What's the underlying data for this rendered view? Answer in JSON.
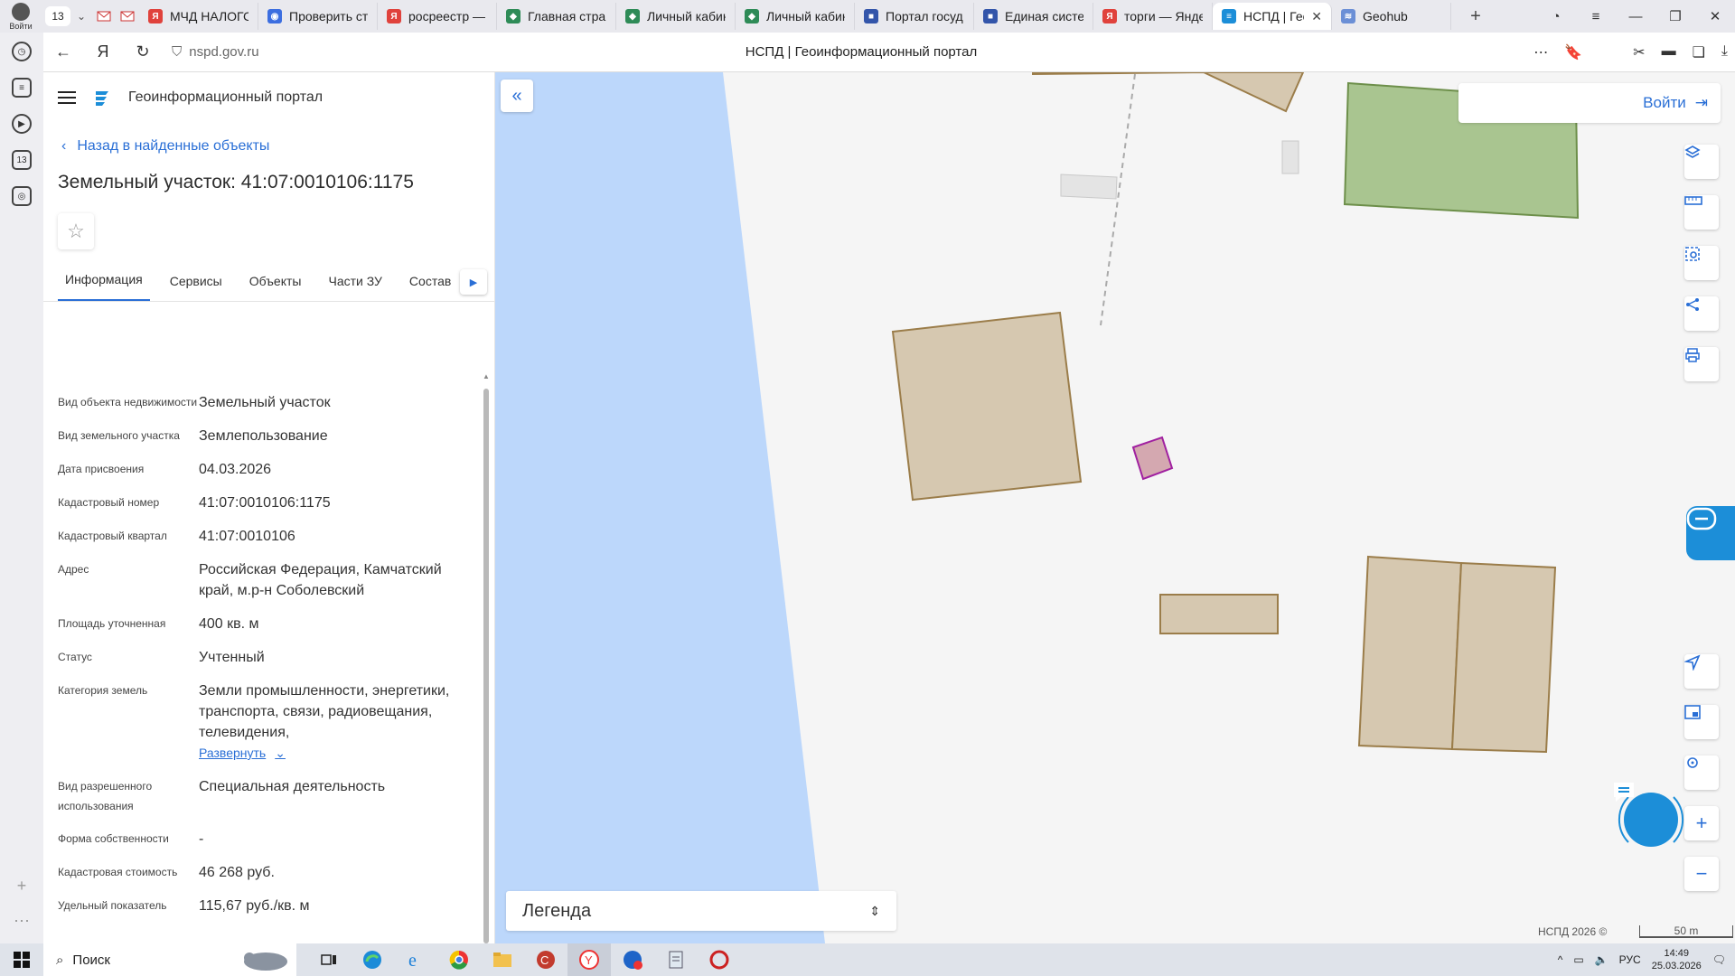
{
  "browser": {
    "profile_label": "Войти",
    "tab_count": "13",
    "tabs": [
      {
        "label": "МЧД НАЛОГС",
        "color": "#e0423c",
        "glyph": "Я"
      },
      {
        "label": "Проверить ст",
        "color": "#3c6ee0",
        "glyph": "◉"
      },
      {
        "label": "росреестр — Я",
        "color": "#e0423c",
        "glyph": "Я"
      },
      {
        "label": "Главная стран",
        "color": "#2e8b57",
        "glyph": "◆"
      },
      {
        "label": "Личный кабин",
        "color": "#2e8b57",
        "glyph": "◆"
      },
      {
        "label": "Личный кабин",
        "color": "#2e8b57",
        "glyph": "◆"
      },
      {
        "label": "Портал госуд",
        "color": "#3355aa",
        "glyph": "■"
      },
      {
        "label": "Единая систе",
        "color": "#3355aa",
        "glyph": "■"
      },
      {
        "label": "торги — Янде",
        "color": "#e0423c",
        "glyph": "Я"
      },
      {
        "label": "НСПД | Гео",
        "color": "#1c8ed8",
        "glyph": "≡"
      },
      {
        "label": "Geohub",
        "color": "#6b8fd6",
        "glyph": "≋"
      }
    ],
    "url": "nspd.gov.ru",
    "page_title": "НСПД | Геоинформационный портал"
  },
  "panel": {
    "portal_name": "Геоинформационный портал",
    "back_label": "Назад в найденные объекты",
    "object_title": "Земельный участок: 41:07:0010106:1175",
    "tabs": [
      "Информация",
      "Сервисы",
      "Объекты",
      "Части ЗУ",
      "Состав"
    ],
    "rows": [
      {
        "label": "Вид объекта недвижимости",
        "value": "Земельный участок"
      },
      {
        "label": "Вид земельного участка",
        "value": "Землепользование"
      },
      {
        "label": "Дата присвоения",
        "value": "04.03.2026"
      },
      {
        "label": "Кадастровый номер",
        "value": "41:07:0010106:1175"
      },
      {
        "label": "Кадастровый квартал",
        "value": "41:07:0010106"
      },
      {
        "label": "Адрес",
        "value": "Российская Федерация, Камчатский край, м.р-н Соболевский"
      },
      {
        "label": "Площадь уточненная",
        "value": "400 кв. м"
      },
      {
        "label": "Статус",
        "value": "Учтенный"
      },
      {
        "label": "Категория земель",
        "value": "Земли промышленности, энергетики, транспорта, связи, радиовещания, телевидения,"
      },
      {
        "label": "Вид разрешенного использования",
        "value": "Специальная деятельность"
      },
      {
        "label": "Форма собственности",
        "value": "-"
      },
      {
        "label": "Кадастровая стоимость",
        "value": "46 268 руб."
      },
      {
        "label": "Удельный показатель",
        "value": "115,67 руб./кв. м"
      }
    ],
    "expand_label": "Развернуть"
  },
  "map": {
    "login_label": "Войти",
    "legend_label": "Легенда",
    "copyright": "НСПД 2026 ©",
    "scale": "50 m",
    "colors": {
      "water": "#bcd7fb",
      "parcel_fill": "#d6c8b0",
      "parcel_stroke": "#9b7d4a",
      "green_fill": "#a9c590",
      "selected_fill": "#d4a8b0",
      "selected_stroke": "#a020a0"
    }
  },
  "taskbar": {
    "search_label": "Поиск",
    "lang": "РУС",
    "time": "14:49",
    "date": "25.03.2026"
  }
}
